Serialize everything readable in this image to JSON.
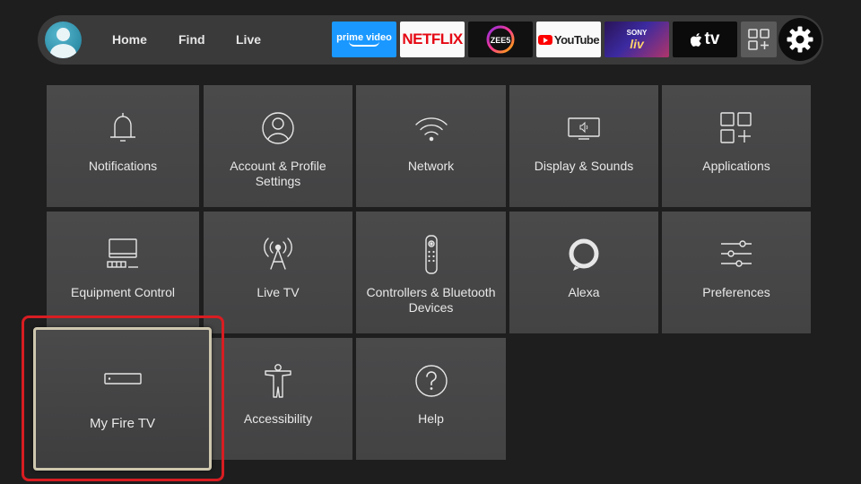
{
  "nav": {
    "home": "Home",
    "find": "Find",
    "live": "Live"
  },
  "apps": {
    "prime": "prime video",
    "netflix": "NETFLIX",
    "zee5": "ZEE5",
    "youtube": "YouTube",
    "sonyliv_top": "SONY",
    "sonyliv_bottom": "liv",
    "appletv": "tv"
  },
  "tiles": {
    "notifications": "Notifications",
    "account": "Account & Profile Settings",
    "network": "Network",
    "display": "Display & Sounds",
    "applications": "Applications",
    "equipment": "Equipment Control",
    "livetv": "Live TV",
    "controllers": "Controllers & Bluetooth Devices",
    "alexa": "Alexa",
    "preferences": "Preferences",
    "myfiretv": "My Fire TV",
    "accessibility": "Accessibility",
    "help": "Help"
  },
  "colors": {
    "background": "#1e1e1f",
    "tile": "#4a4a4b",
    "focus_border": "#cfc7ae",
    "highlight": "#d81d22",
    "prime": "#1a98ff",
    "netflix": "#e50914"
  },
  "icons": [
    "avatar",
    "settings-gear-icon",
    "all-apps-icon",
    "bell-icon",
    "person-icon",
    "wifi-icon",
    "display-icon",
    "apps-grid-icon",
    "computer-icon",
    "antenna-icon",
    "remote-icon",
    "alexa-ring-icon",
    "sliders-icon",
    "firetv-stick-icon",
    "accessibility-icon",
    "help-icon"
  ]
}
